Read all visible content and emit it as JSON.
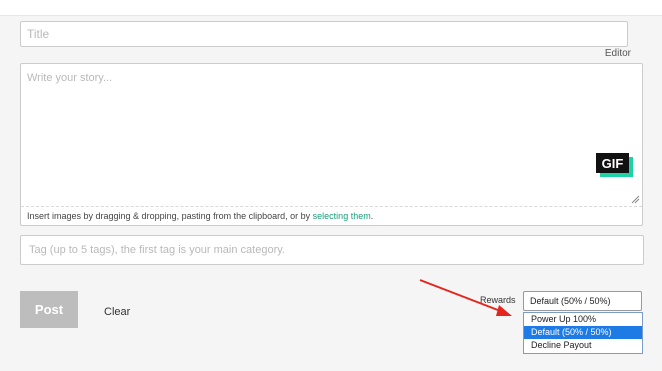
{
  "form": {
    "title_placeholder": "Title",
    "editor_link": "Editor",
    "story_placeholder": "Write your story...",
    "gif_button": "GIF",
    "dropzone_hint_prefix": "Insert images by dragging & dropping, pasting from the clipboard, or by ",
    "dropzone_hint_link": "selecting them",
    "dropzone_hint_suffix": ".",
    "tags_placeholder": "Tag (up to 5 tags), the first tag is your main category."
  },
  "actions": {
    "post_label": "Post",
    "clear_label": "Clear"
  },
  "rewards": {
    "label": "Rewards",
    "selected": "Default (50% / 50%)",
    "options": [
      "Power Up 100%",
      "Default (50% / 50%)",
      "Decline Payout"
    ],
    "highlighted_option_index": 1
  },
  "colors": {
    "annotation_arrow": "#e5251d",
    "gif_accent": "#1ed3a3",
    "link": "#1a9e7a",
    "option_highlight": "#1e7be6",
    "post_button_disabled": "#bdbdbd"
  },
  "icons": {
    "resize_handle": "resize-grip-icon",
    "annotation": "red-arrow-annotation"
  }
}
